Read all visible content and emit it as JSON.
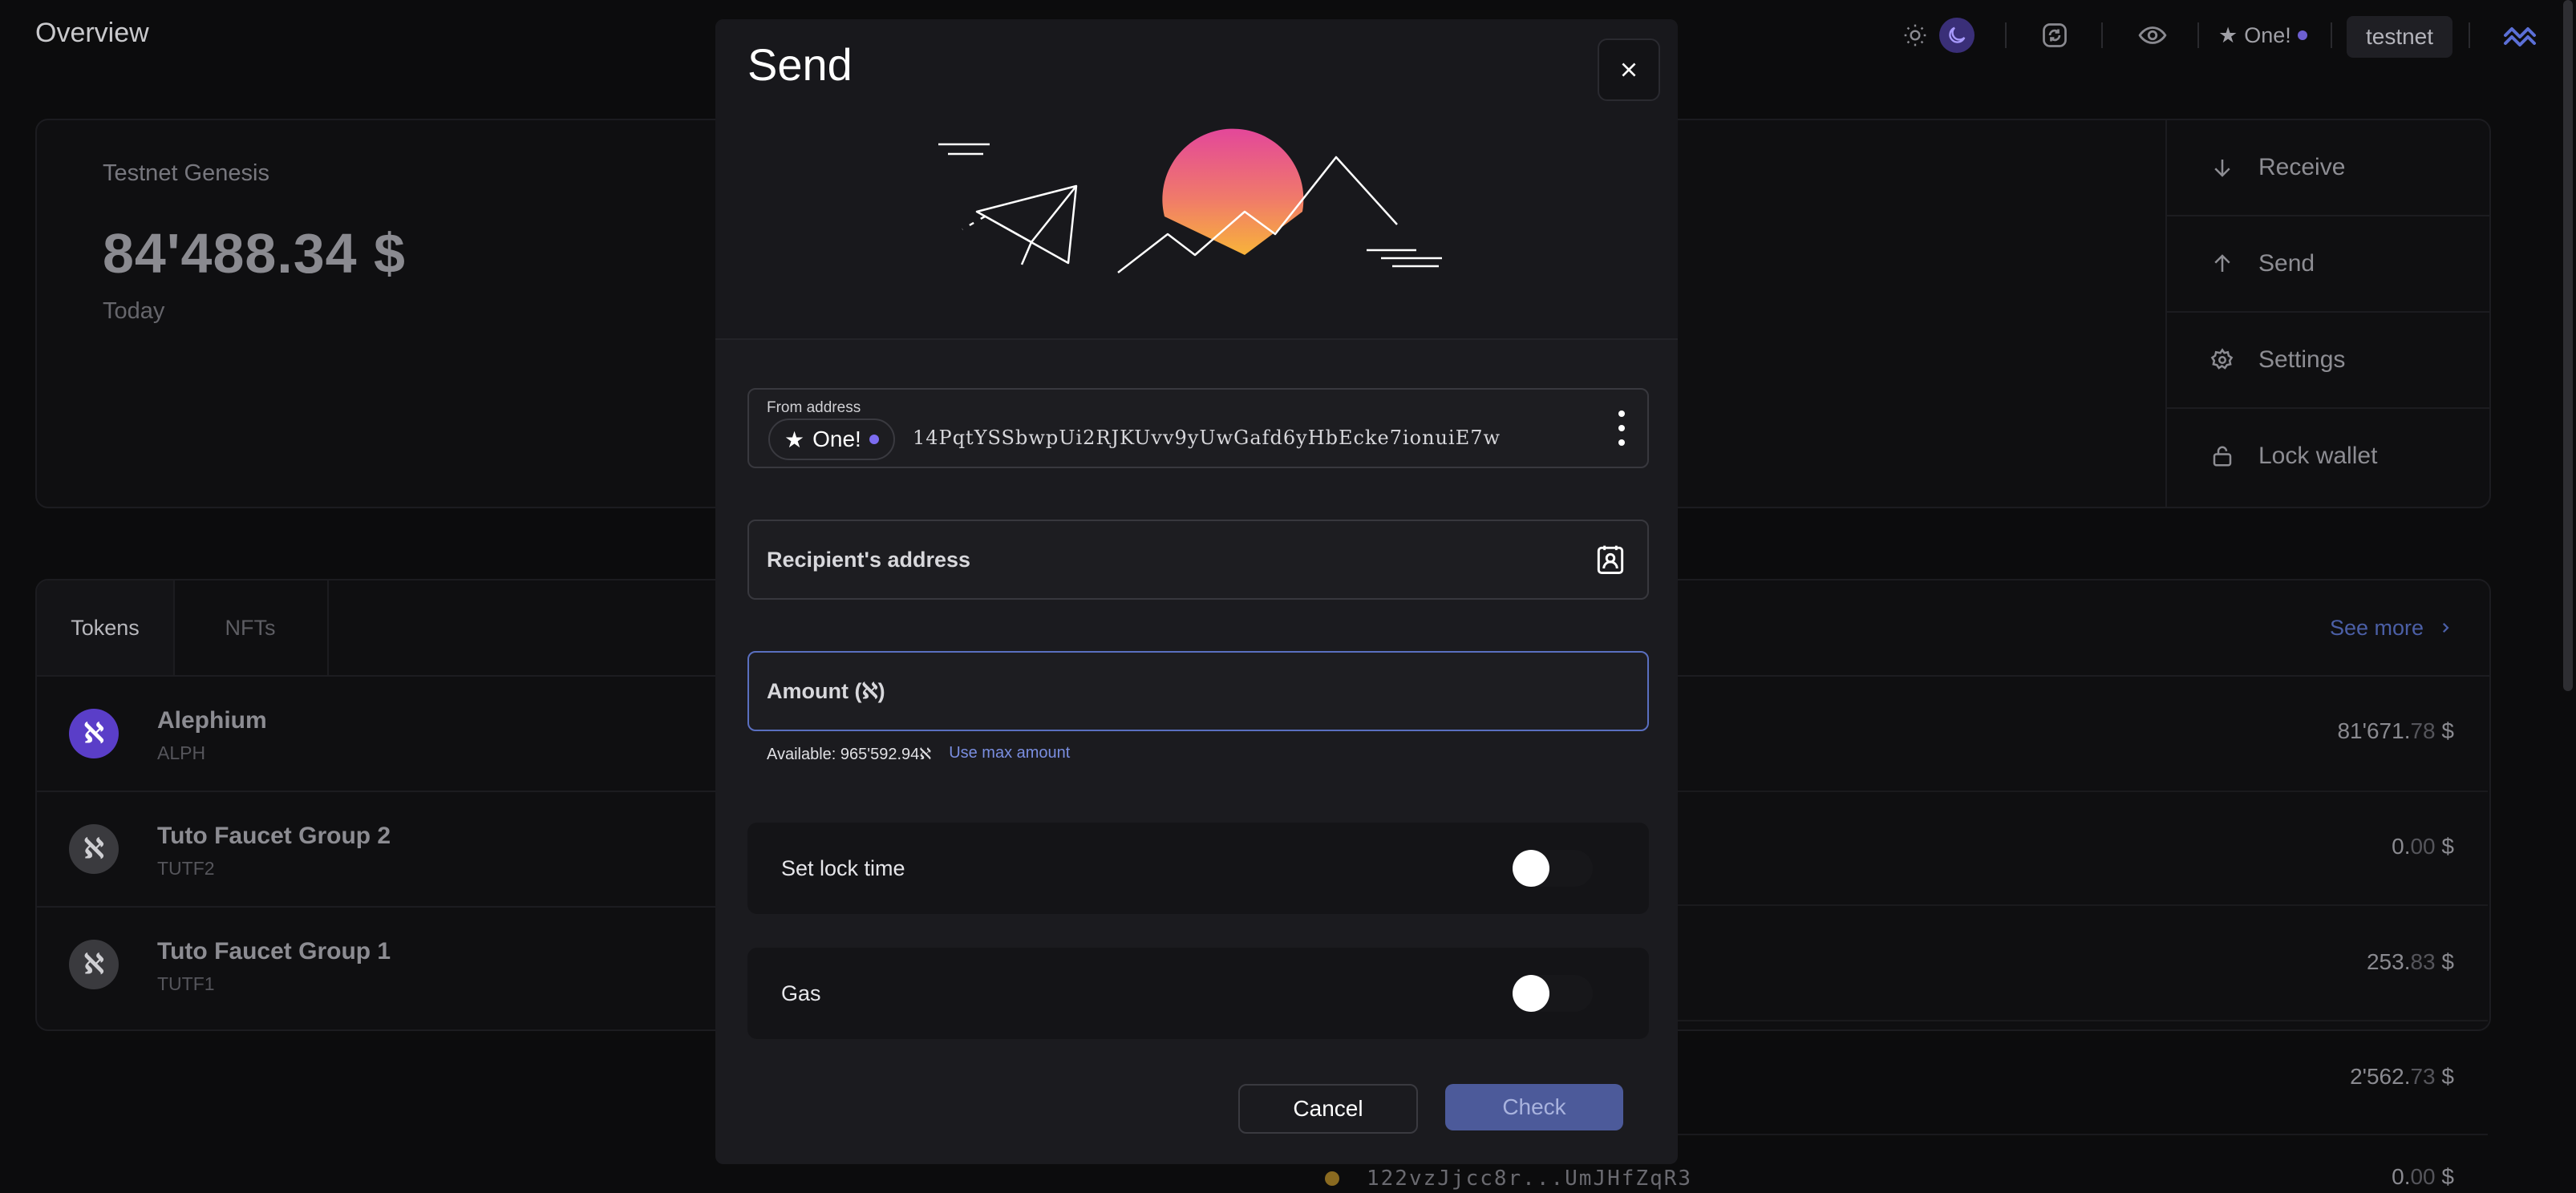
{
  "topbar": {
    "title": "Overview",
    "address_badge": {
      "star": "★",
      "label": "One!"
    },
    "network": "testnet"
  },
  "overview": {
    "wallet_name": "Testnet Genesis",
    "amount": "84'488.34 $",
    "period": "Today",
    "actions": [
      "Receive",
      "Send",
      "Settings",
      "Lock wallet"
    ]
  },
  "tokens": {
    "tabs": [
      "Tokens",
      "NFTs"
    ],
    "see_more": "See more",
    "items": [
      {
        "name": "Alephium",
        "symbol": "ALPH",
        "logo": "ℵ",
        "color": "#5a3ec8"
      },
      {
        "name": "Tuto Faucet Group 2",
        "symbol": "TUTF2",
        "logo": "ℵ",
        "color": "#3a3a3e"
      },
      {
        "name": "Tuto Faucet Group 1",
        "symbol": "TUTF1",
        "logo": "ℵ",
        "color": "#3a3a3e"
      }
    ]
  },
  "values": [
    {
      "int": "81'671.",
      "dec": "78",
      "cur": " $"
    },
    {
      "int": "0.",
      "dec": "00",
      "cur": " $"
    },
    {
      "int": "253.",
      "dec": "83",
      "cur": " $"
    },
    {
      "int": "2'562.",
      "dec": "73",
      "cur": " $"
    },
    {
      "int": "0.",
      "dec": "00",
      "cur": " $"
    }
  ],
  "bottom_address": "122vzJjcc8r...UmJHfZqR3",
  "modal": {
    "title": "Send",
    "from_label": "From address",
    "from_badge": {
      "star": "★",
      "label": "One!"
    },
    "from_hash": "14PqtYSSbwpUi2RJKUvv9yUwGafd6yHbEcke7ionuiE7w",
    "recipient_label": "Recipient's address",
    "amount_label": "Amount (ℵ)",
    "available": "Available: 965'592.94ℵ",
    "use_max": "Use max amount",
    "lock_time_label": "Set lock time",
    "gas_label": "Gas",
    "cancel": "Cancel",
    "check": "Check"
  }
}
